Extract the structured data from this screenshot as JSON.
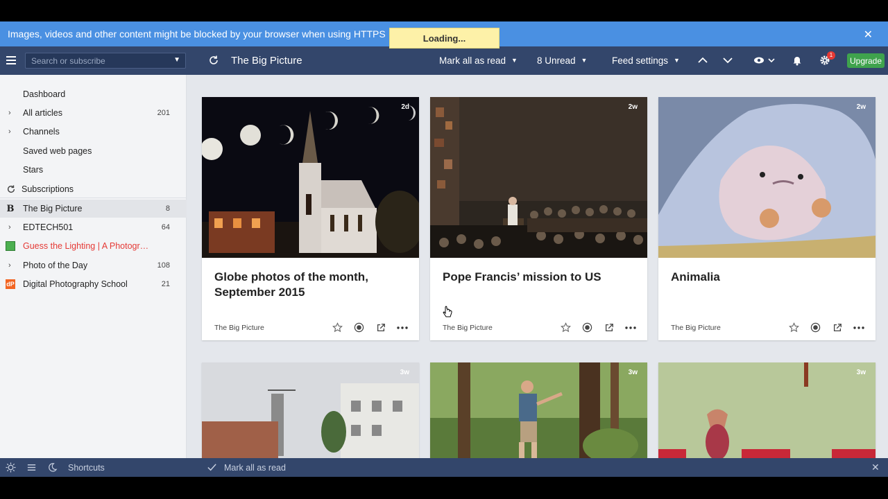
{
  "banner": {
    "message": "Images, videos and other content might be blocked by your browser when using HTTPS",
    "loading": "Loading..."
  },
  "toolbar": {
    "search_placeholder": "Search or subscribe",
    "feed_title": "The Big Picture",
    "mark_all": "Mark all as read",
    "unread": "8 Unread",
    "feed_settings": "Feed settings",
    "notification_count": "1",
    "upgrade": "Upgrade"
  },
  "sidebar": {
    "top_items": [
      {
        "label": "Dashboard",
        "count": ""
      },
      {
        "label": "All articles",
        "count": "201"
      },
      {
        "label": "Channels",
        "count": ""
      },
      {
        "label": "Saved web pages",
        "count": ""
      },
      {
        "label": "Stars",
        "count": ""
      }
    ],
    "subscriptions_label": "Subscriptions",
    "feeds": [
      {
        "label": "The Big Picture",
        "count": "8"
      },
      {
        "label": "EDTECH501",
        "count": "64"
      },
      {
        "label": "Guess the Lighting | A Photogr…",
        "count": ""
      },
      {
        "label": "Photo of the Day",
        "count": "108"
      },
      {
        "label": "Digital Photography School",
        "count": "21"
      }
    ]
  },
  "cards": [
    {
      "title": "Globe photos of the month, September 2015",
      "source": "The Big Picture",
      "age": "2d"
    },
    {
      "title": "Pope Francis’ mission to US",
      "source": "The Big Picture",
      "age": "2w"
    },
    {
      "title": "Animalia",
      "source": "The Big Picture",
      "age": "2w"
    },
    {
      "title": "",
      "source": "",
      "age": "3w"
    },
    {
      "title": "",
      "source": "",
      "age": "3w"
    },
    {
      "title": "",
      "source": "",
      "age": "3w"
    }
  ],
  "bottombar": {
    "shortcuts": "Shortcuts",
    "mark_all": "Mark all as read"
  }
}
